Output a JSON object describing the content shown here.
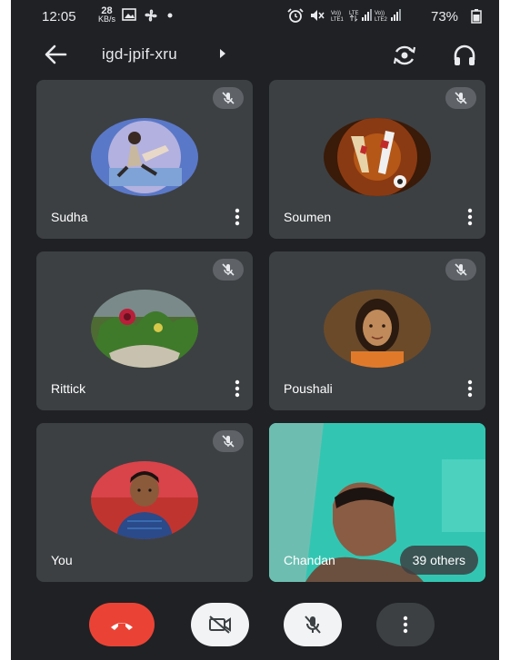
{
  "status_bar": {
    "time": "12:05",
    "net_speed_value": "28",
    "net_speed_unit": "KB/s",
    "battery": "73%"
  },
  "header": {
    "meeting_code": "igd-jpif-xru"
  },
  "participants": [
    {
      "name": "Sudha",
      "muted": true,
      "avatar_color": "#5a78c8"
    },
    {
      "name": "Soumen",
      "muted": true,
      "avatar_color": "#8a3a12"
    },
    {
      "name": "Rittick",
      "muted": true,
      "avatar_color": "#4d6b33"
    },
    {
      "name": "Poushali",
      "muted": true,
      "avatar_color": "#6b4a2a"
    },
    {
      "name": "You",
      "muted": true,
      "avatar_color": "#c0342f"
    },
    {
      "name": "Chandan",
      "video": true
    }
  ],
  "others_badge": "39 others",
  "colors": {
    "background": "#202124",
    "tile": "#3c4043",
    "end_call": "#ea4335",
    "control_light": "#f1f3f4",
    "control_dark": "#3c4043"
  },
  "icons": {
    "back": "arrow-left-icon",
    "switch_camera": "switch-camera-icon",
    "audio": "headphones-icon",
    "muted": "mic-off-icon",
    "more": "more-vertical-icon",
    "end_call": "phone-hangup-icon",
    "camera": "video-off-icon"
  }
}
